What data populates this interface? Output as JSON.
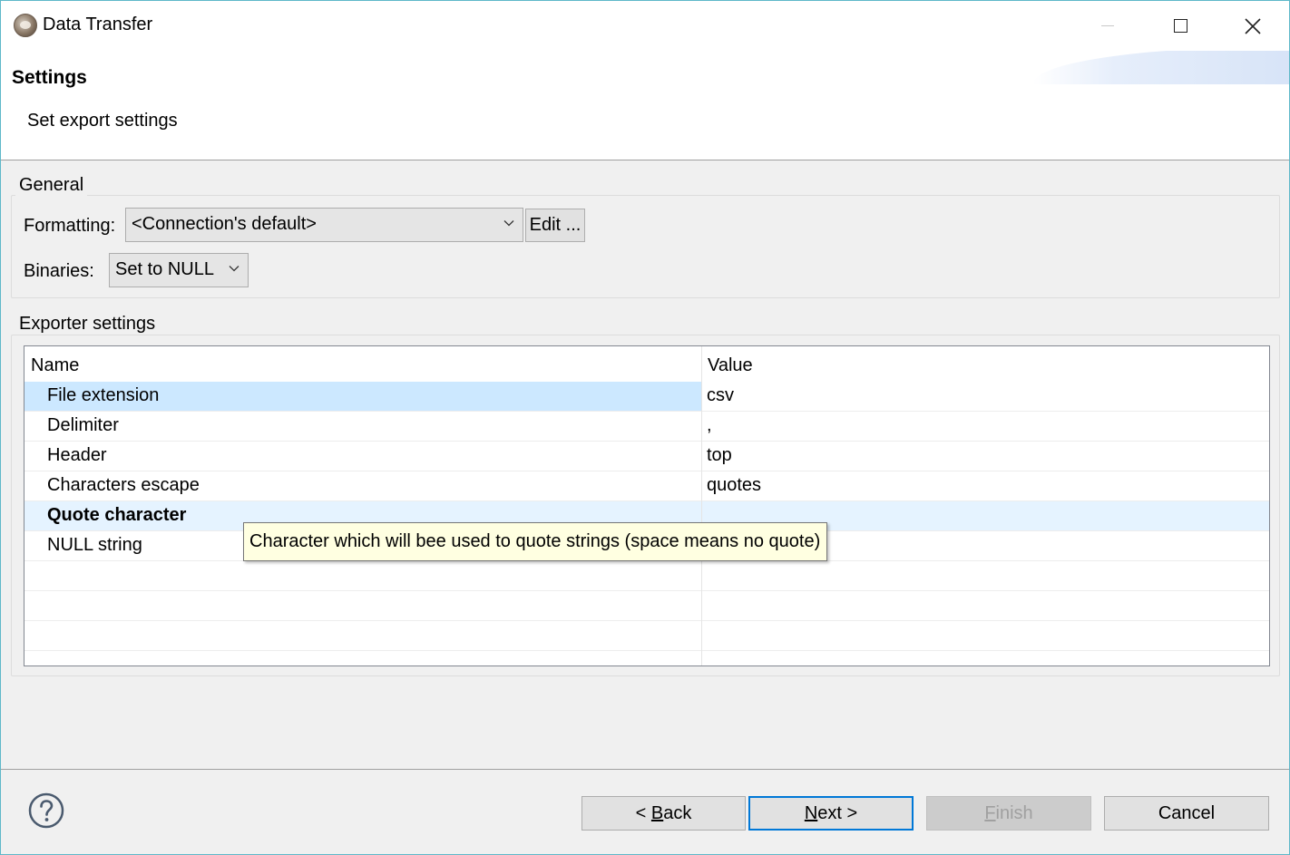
{
  "window": {
    "title": "Data Transfer"
  },
  "header": {
    "title": "Settings",
    "description": "Set export settings"
  },
  "general": {
    "legend": "General",
    "formatting_label": "Formatting:",
    "formatting_value": "<Connection's default>",
    "edit_button": "Edit ...",
    "binaries_label": "Binaries:",
    "binaries_value": "Set to NULL"
  },
  "exporter": {
    "legend": "Exporter settings",
    "columns": [
      "Name",
      "Value"
    ],
    "rows": [
      {
        "name": "File extension",
        "value": "csv",
        "selected": true,
        "bold": false
      },
      {
        "name": "Delimiter",
        "value": ",",
        "selected": false,
        "bold": false
      },
      {
        "name": "Header",
        "value": "top",
        "selected": false,
        "bold": false
      },
      {
        "name": "Characters escape",
        "value": "quotes",
        "selected": false,
        "bold": false
      },
      {
        "name": "Quote character",
        "value": "",
        "selected": false,
        "bold": true,
        "hovered": true
      },
      {
        "name": "NULL string",
        "value": "",
        "selected": false,
        "bold": false
      }
    ],
    "empty_rows": 3
  },
  "tooltip": {
    "text": "Character which will bee used to quote strings (space means no quote)"
  },
  "footer": {
    "back_prefix": "< ",
    "back_mnemonic": "B",
    "back_rest": "ack",
    "next_mnemonic": "N",
    "next_rest": "ext >",
    "finish_mnemonic": "F",
    "finish_rest": "inish",
    "cancel_label": "Cancel"
  },
  "colors": {
    "selection": "#cce8ff",
    "hover": "#e5f3ff",
    "tooltip_bg": "#ffffe1",
    "default_button_border": "#0078d7",
    "window_border": "#5fb8c9"
  },
  "icons": {
    "app": "dbeaver-beaver-icon",
    "help": "question-circle-icon",
    "dropdown": "chevron-down-icon"
  }
}
